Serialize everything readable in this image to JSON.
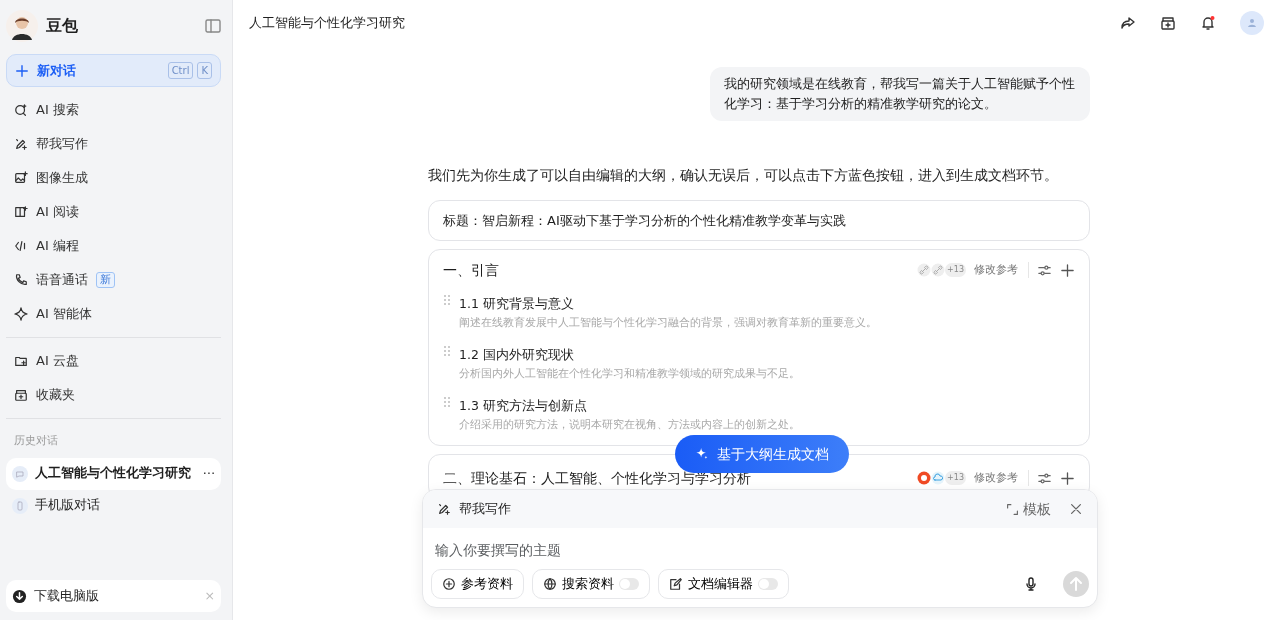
{
  "app": {
    "name": "豆包"
  },
  "sidebar": {
    "new_chat": {
      "label": "新对话",
      "shortcut": [
        "Ctrl",
        "K"
      ]
    },
    "items": [
      {
        "label": "AI 搜索"
      },
      {
        "label": "帮我写作"
      },
      {
        "label": "图像生成"
      },
      {
        "label": "AI 阅读"
      },
      {
        "label": "AI 编程"
      },
      {
        "label": "语音通话",
        "badge": "新"
      },
      {
        "label": "AI 智能体"
      }
    ],
    "items2": [
      {
        "label": "AI 云盘"
      },
      {
        "label": "收藏夹"
      }
    ],
    "history_title": "历史对话",
    "history": [
      {
        "label": "人工智能与个性化学习研究",
        "selected": true,
        "more": "⋯"
      },
      {
        "label": "手机版对话",
        "selected": false
      }
    ],
    "download": {
      "label": "下载电脑版",
      "close": "×"
    }
  },
  "header": {
    "title": "人工智能与个性化学习研究",
    "notification": true
  },
  "messages": [
    {
      "kind": "user",
      "text": "我的研究领域是在线教育，帮我写一篇关于人工智能赋予个性化学习：基于学习分析的精准教学研究的论文。"
    },
    {
      "kind": "assistant",
      "text": "我们先为你生成了可以自由编辑的大纲，确认无误后，可以点击下方蓝色按钮，进入到生成文档环节。"
    }
  ],
  "outline": {
    "title": "标题：智启新程：AI驱动下基于学习分析的个性化精准教学变革与实践",
    "sections": [
      {
        "heading": "一、引言",
        "ref_count": "+13",
        "ref_label": "修改参考",
        "subsections": [
          {
            "title": "1.1 研究背景与意义",
            "desc": "阐述在线教育发展中人工智能与个性化学习融合的背景，强调对教育革新的重要意义。"
          },
          {
            "title": "1.2 国内外研究现状",
            "desc": "分析国内外人工智能在个性化学习和精准教学领域的研究成果与不足。"
          },
          {
            "title": "1.3 研究方法与创新点",
            "desc": "介绍采用的研究方法，说明本研究在视角、方法或内容上的创新之处。"
          }
        ]
      },
      {
        "heading": "二、理论基石：人工智能、个性化学习与学习分析",
        "ref_count": "+13",
        "ref_label": "修改参考"
      }
    ]
  },
  "generate_button": "基于大纲生成文档",
  "composer": {
    "mode": "帮我写作",
    "template": "模板",
    "placeholder": "输入你要撰写的主题",
    "tools": [
      {
        "label": "参考资料",
        "kind": "button"
      },
      {
        "label": "搜索资料",
        "kind": "toggle",
        "on": false
      },
      {
        "label": "文档编辑器",
        "kind": "toggle",
        "on": false
      }
    ]
  }
}
